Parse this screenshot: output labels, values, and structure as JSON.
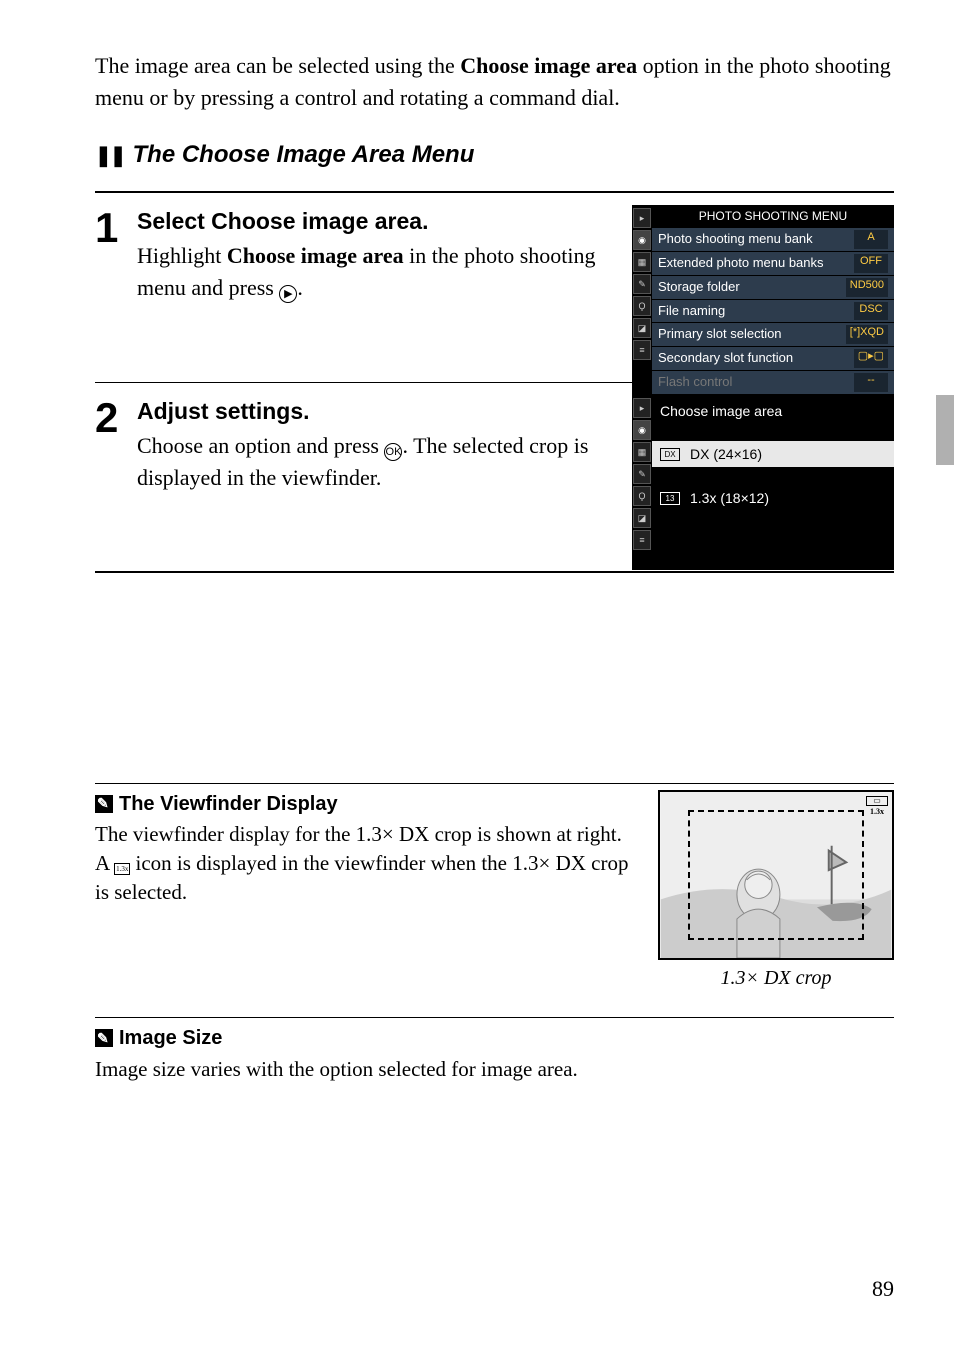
{
  "intro": {
    "part1": "The image area can be selected using the ",
    "bold1": "Choose image area",
    "part2": " option in the photo shooting menu or by pressing a control and rotating a command dial."
  },
  "section_title": "The Choose Image Area Menu",
  "steps": [
    {
      "num": "1",
      "title_a": "Select ",
      "title_b": "Choose image area",
      "title_c": ".",
      "body_a": "Highlight ",
      "body_b": "Choose image area",
      "body_c": " in the photo shooting menu and press ",
      "body_d": "."
    },
    {
      "num": "2",
      "title_a": "Adjust settings.",
      "title_b": "",
      "title_c": "",
      "body_a": "Choose an option and press ",
      "body_b": ".  The selected crop is displayed in the viewfinder.",
      "body_c": "",
      "body_d": ""
    }
  ],
  "menu1": {
    "title": "PHOTO SHOOTING MENU",
    "rows": [
      {
        "label": "Photo shooting menu bank",
        "val": "A"
      },
      {
        "label": "Extended photo menu banks",
        "val": "OFF"
      },
      {
        "label": "Storage folder",
        "val": "ND500"
      },
      {
        "label": "File naming",
        "val": "DSC"
      },
      {
        "label": "Primary slot selection",
        "val": "[*]XQD"
      },
      {
        "label": "Secondary slot function",
        "val": "▢▸▢"
      },
      {
        "label": "Flash control",
        "val": "--",
        "disabled": true
      },
      {
        "label": "Choose image area",
        "val": "▭",
        "highlight": true
      }
    ]
  },
  "menu2": {
    "title": "Choose image area",
    "opt1": "DX  (24×16)",
    "opt2": "1.3x (18×12)"
  },
  "note1": {
    "title": "The Viewfinder Display",
    "text_a": "The viewfinder display for the 1.3× DX crop is shown at right.  A ",
    "text_b": " icon is displayed in the viewfinder when the 1.3× DX crop is selected."
  },
  "vf_caption": "1.3× DX crop",
  "vf_badge_top": "▭",
  "vf_badge_bot": "1.3x",
  "note2": {
    "title": "Image Size",
    "text": "Image size varies with the option selected for image area."
  },
  "page_number": "89"
}
